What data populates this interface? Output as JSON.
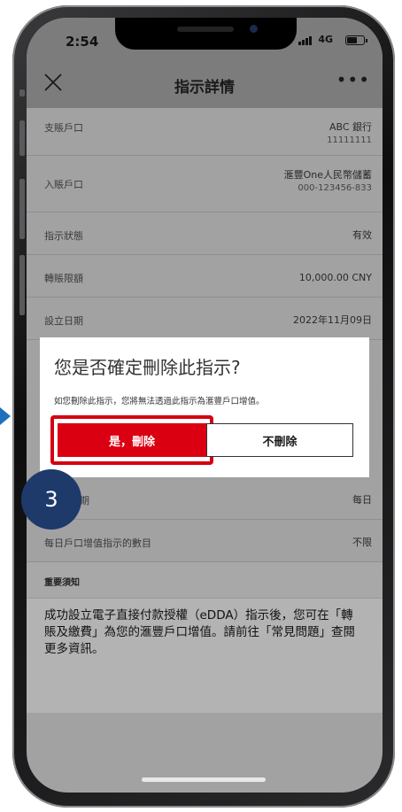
{
  "status_bar": {
    "time": "2:54",
    "network": "4G"
  },
  "nav": {
    "title": "指示詳情",
    "more_label": "•••"
  },
  "rows": [
    {
      "label": "支賬戶口",
      "value": "ABC 銀行",
      "sub": "11111111"
    },
    {
      "label": "入賬戶口",
      "value": "滙豐One人民幣儲蓄",
      "sub": "000-123456-833"
    },
    {
      "label": "指示狀態",
      "value": "有效"
    },
    {
      "label": "轉賬限額",
      "value": "10,000.00 CNY"
    },
    {
      "label": "設立日期",
      "value": "2022年11月09日"
    },
    {
      "label": "期",
      "value": "每日"
    },
    {
      "label": "每日戶口增值指示的數目",
      "value": "不限"
    }
  ],
  "dialog": {
    "question": "您是否確定刪除此指示?",
    "message": "如您刪除此指示，您將無法透過此指示為滙豐戶口增值。",
    "confirm_label": "是，刪除",
    "cancel_label": "不刪除"
  },
  "step_badge": "3",
  "notice": {
    "heading": "重要須知",
    "body": "成功設立電子直接付款授權（eDDA）指示後，您可在「轉賬及繳費」為您的滙豐戶口增值。請前往「常見問題」查閱更多資訊。"
  },
  "colors": {
    "accent": "#db0011",
    "badge": "#1d3a6b"
  }
}
